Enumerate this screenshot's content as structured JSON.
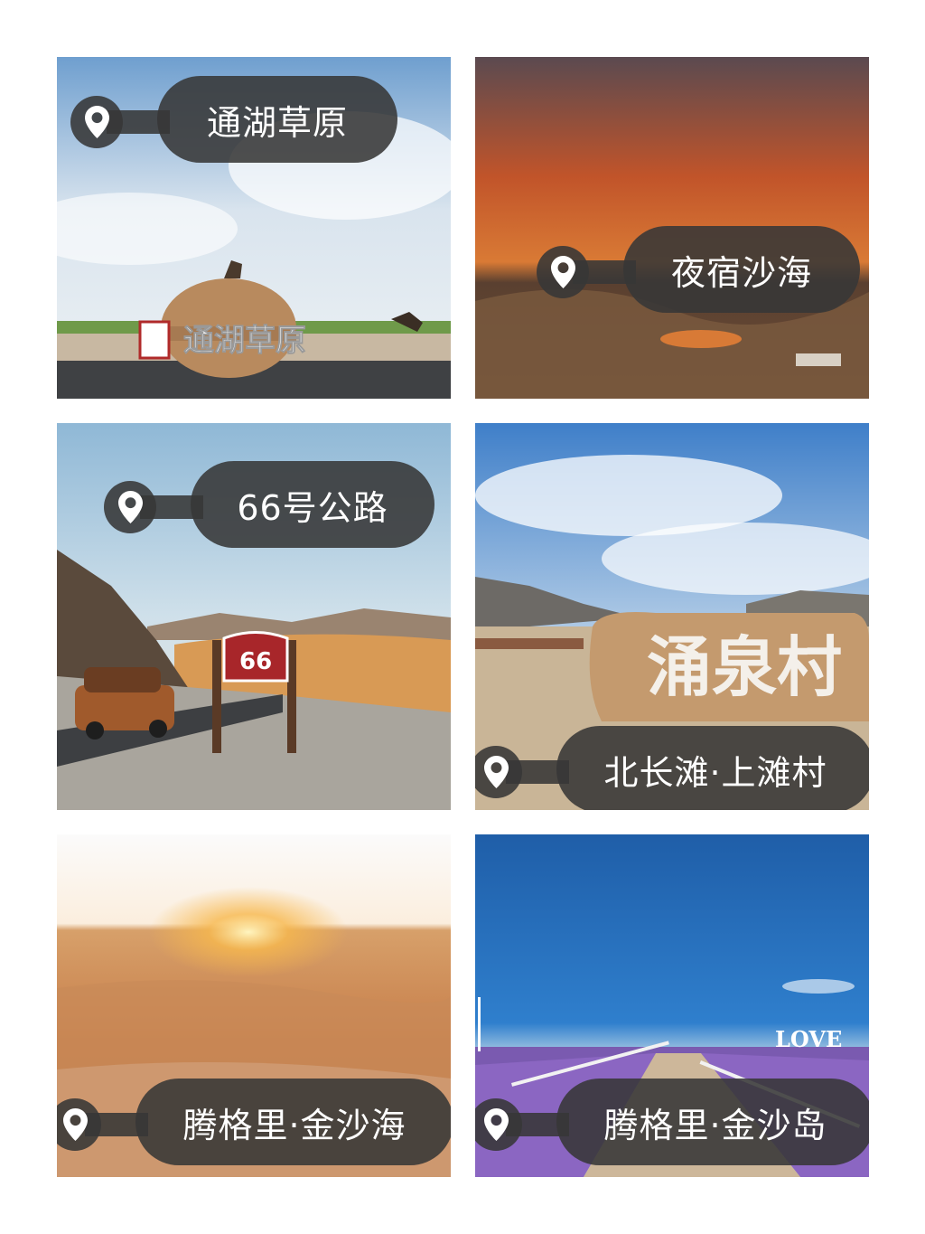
{
  "tiles": [
    {
      "label": "通湖草原",
      "pin_icon": "location-pin-icon",
      "sign_text": "通湖草原"
    },
    {
      "label": "夜宿沙海",
      "pin_icon": "location-pin-icon"
    },
    {
      "label": "66号公路",
      "pin_icon": "location-pin-icon",
      "sign_text": "66"
    },
    {
      "label": "北长滩·上滩村",
      "pin_icon": "location-pin-icon",
      "sign_text": "涌泉村"
    },
    {
      "label": "腾格里·金沙海",
      "pin_icon": "location-pin-icon"
    },
    {
      "label": "腾格里·金沙岛",
      "pin_icon": "location-pin-icon",
      "sign_text": "LOVE"
    }
  ],
  "colors": {
    "tag_bg": "#373737",
    "tag_text": "#ffffff",
    "page_bg": "#ffffff"
  }
}
